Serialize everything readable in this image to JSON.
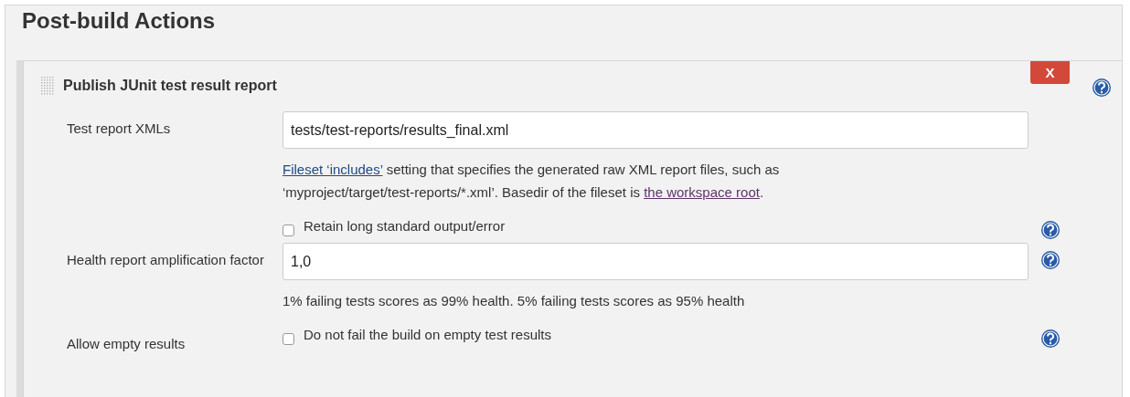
{
  "section_title": "Post-build Actions",
  "step": {
    "title": "Publish JUnit test result report",
    "delete_button": "X"
  },
  "rows": [
    {
      "kind": "text",
      "label": "Test report XMLs",
      "value": "tests/test-reports/results_final.xml",
      "has_help": false,
      "description": [
        {
          "kind": "link",
          "visited": false,
          "text": "Fileset ‘includes’"
        },
        {
          "kind": "plain",
          "text": " setting that specifies the generated raw XML report files, such as ‘myproject/target/test-reports/*.xml’. Basedir of the fileset is "
        },
        {
          "kind": "link",
          "visited": true,
          "text": "the workspace root"
        },
        {
          "kind": "plain",
          "text": "."
        }
      ]
    },
    {
      "kind": "checkbox",
      "text": "Retain long standard output/error",
      "checked": false,
      "has_help": true
    },
    {
      "kind": "text",
      "label": "Health report amplification factor",
      "value": "1,0",
      "has_help": true,
      "description": [
        {
          "kind": "plain",
          "text": "1% failing tests scores as 99% health. 5% failing tests scores as 95% health"
        }
      ]
    },
    {
      "kind": "checkbox",
      "label": "Allow empty results",
      "text": "Do not fail the build on empty test results",
      "checked": false,
      "has_help": true
    }
  ]
}
